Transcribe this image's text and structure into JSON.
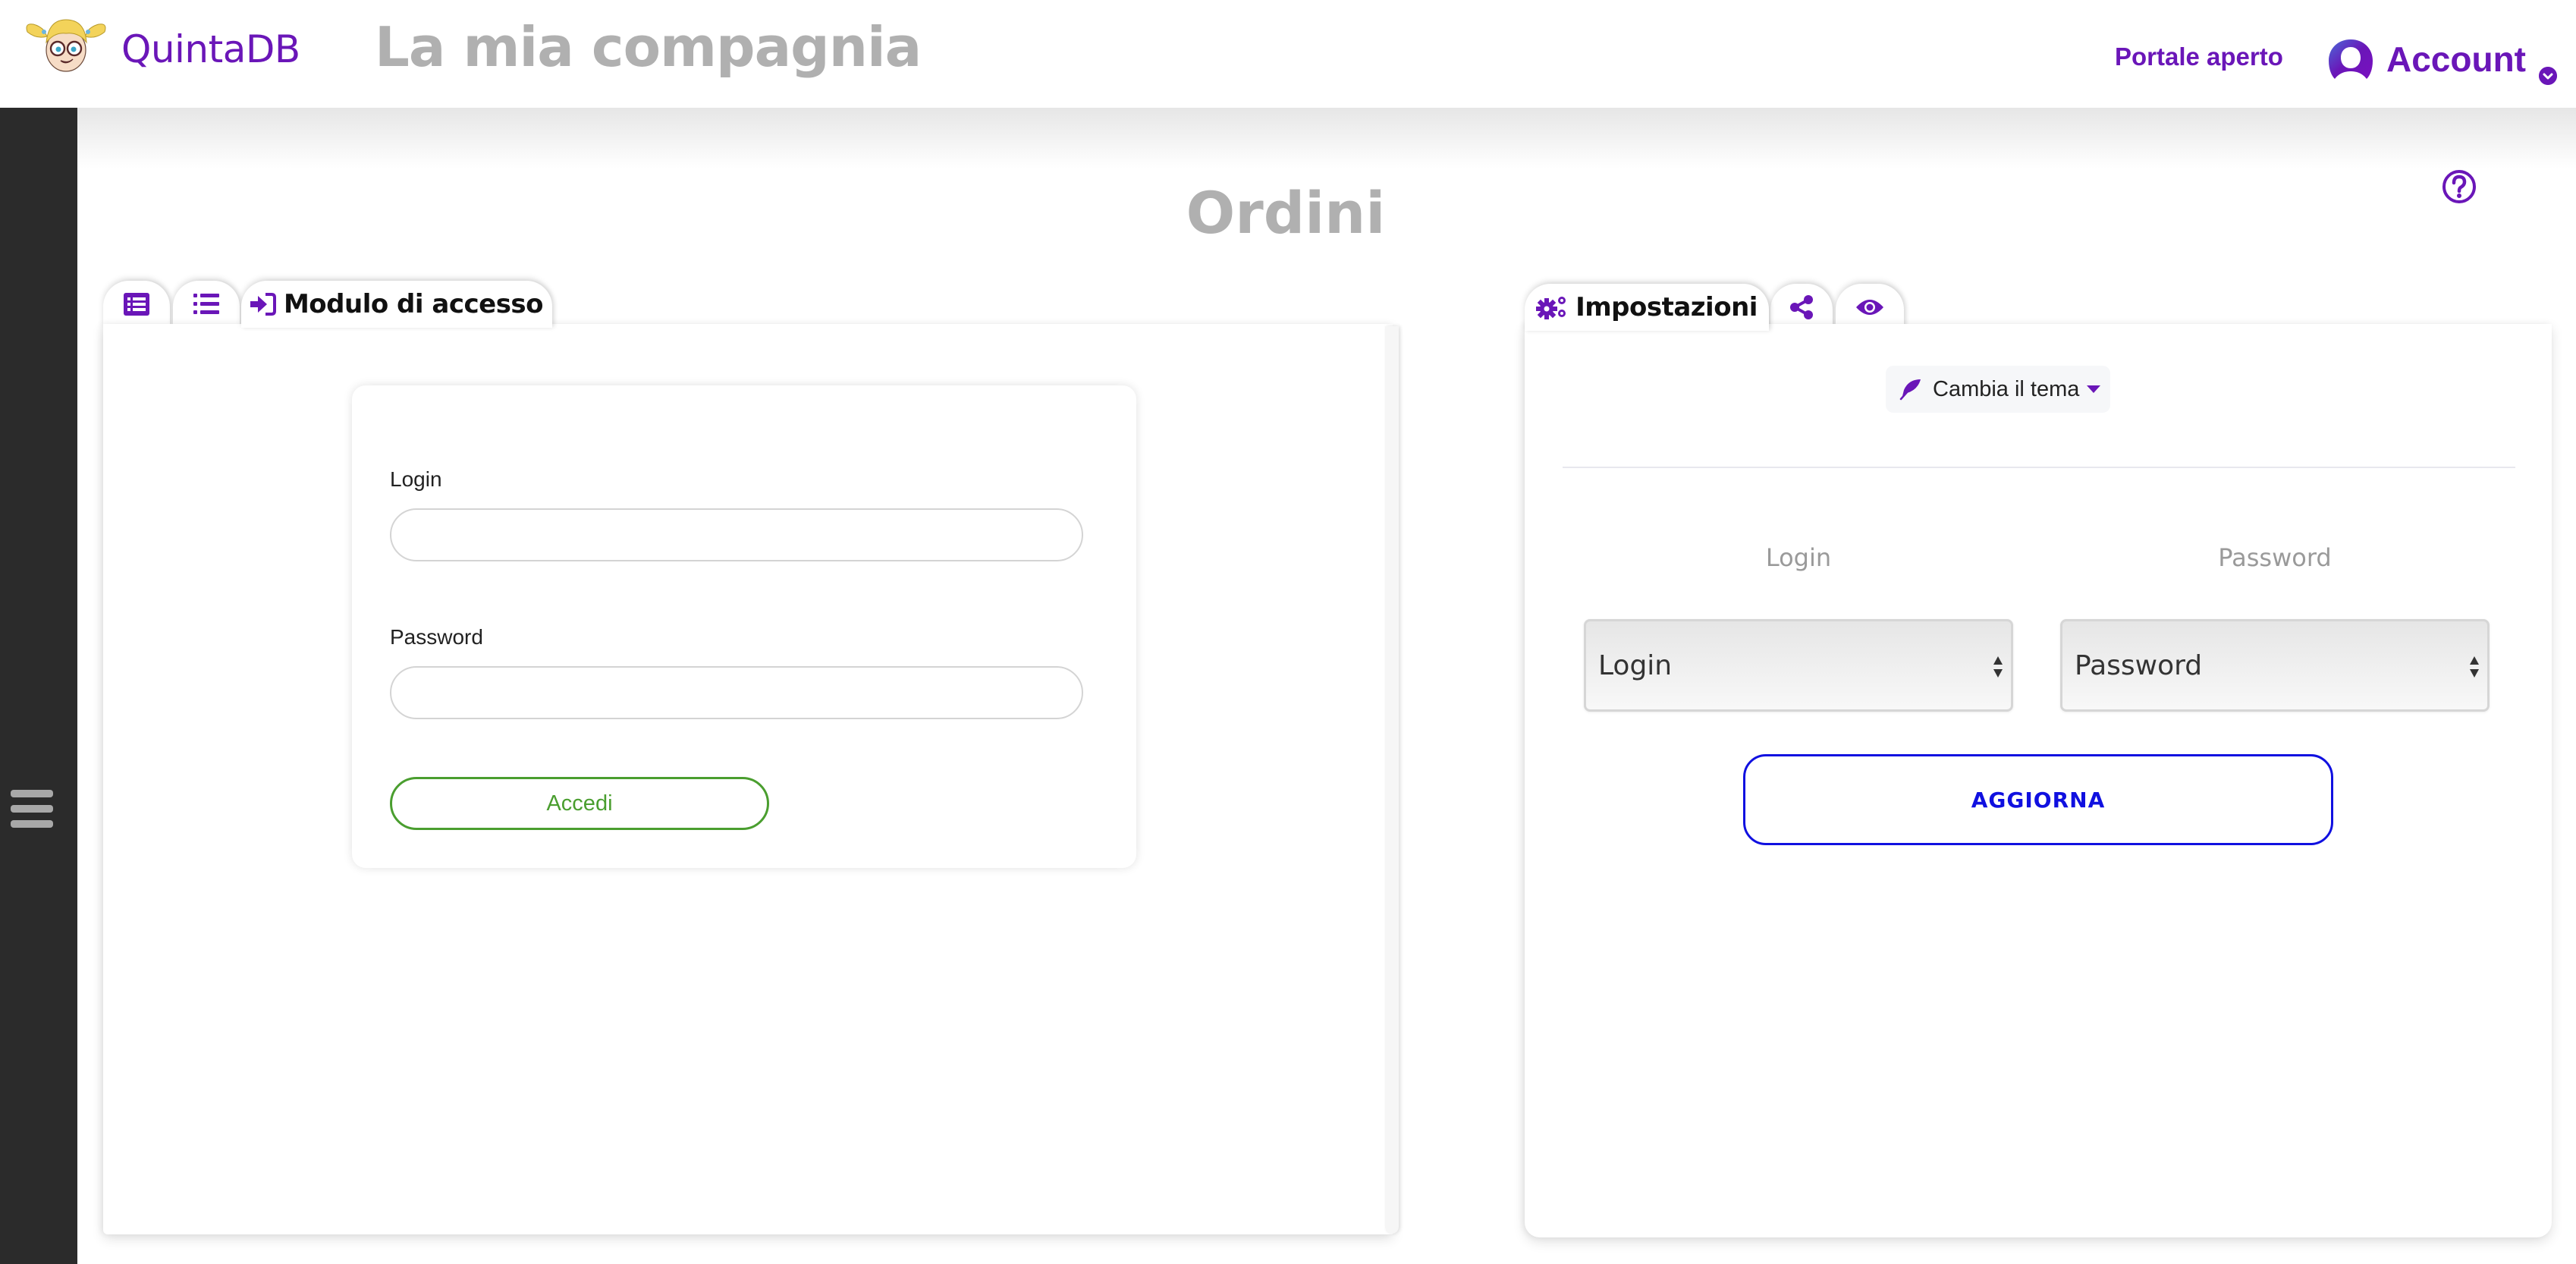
{
  "header": {
    "brand": "QuintaDB",
    "company": "La mia compagnia",
    "portal_link": "Portale aperto",
    "account_label": "Account",
    "logo_icon": "cartoon-girl-logo",
    "account_icon": "user-avatar-icon",
    "account_caret_icon": "chevron-down-circle-icon"
  },
  "sidebar": {
    "menu_icon": "hamburger-icon"
  },
  "page": {
    "title": "Ordini",
    "help_icon": "question-circle-icon"
  },
  "left_tabs": [
    {
      "icon": "table-icon",
      "label": ""
    },
    {
      "icon": "list-icon",
      "label": ""
    },
    {
      "icon": "sign-in-icon",
      "label": "Modulo di accesso",
      "active": true
    }
  ],
  "login_form": {
    "login_label": "Login",
    "login_value": "",
    "password_label": "Password",
    "password_value": "",
    "submit_label": "Accedi"
  },
  "right_tabs": [
    {
      "icon": "cogs-icon",
      "label": "Impostazioni",
      "active": true
    },
    {
      "icon": "share-icon",
      "label": ""
    },
    {
      "icon": "eye-icon",
      "label": ""
    }
  ],
  "settings": {
    "theme_button_label": "Cambia il tema",
    "theme_icon": "feather-icon",
    "mapping": [
      {
        "label": "Login",
        "selected": "Login"
      },
      {
        "label": "Password",
        "selected": "Password"
      }
    ],
    "update_label": "AGGIORNA"
  },
  "colors": {
    "brand": "#6a16b8",
    "sidebar": "#2b2b2b",
    "submit_green": "#4a9e2f",
    "update_blue": "#1010e0",
    "muted_title": "#b0b0b0"
  }
}
